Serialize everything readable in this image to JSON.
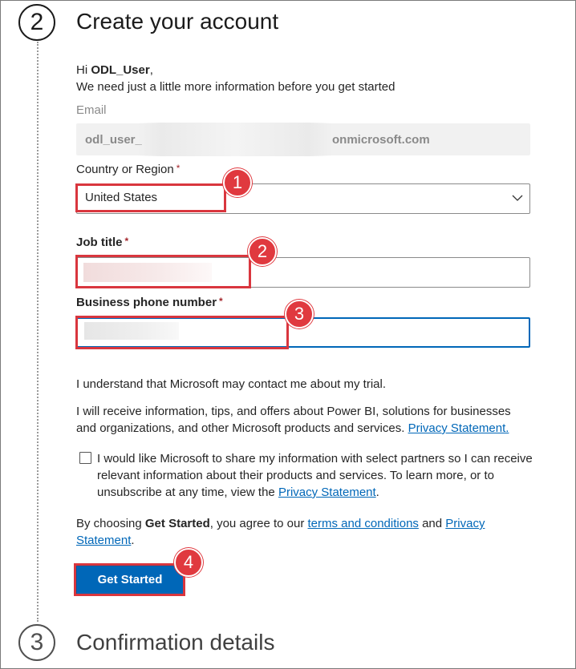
{
  "steps": {
    "current": {
      "number": "2",
      "title": "Create your account"
    },
    "next": {
      "number": "3",
      "title": "Confirmation details"
    }
  },
  "greeting": {
    "hi": "Hi",
    "username": "ODL_User",
    "comma": ",",
    "message": "We need just a little more information before you get started"
  },
  "email": {
    "label": "Email",
    "value_start": "odl_user_",
    "value_end": "onmicrosoft.com"
  },
  "country": {
    "label": "Country or Region",
    "required": "*",
    "value": "United States"
  },
  "job_title": {
    "label": "Job title",
    "required": "*"
  },
  "phone": {
    "label": "Business phone number",
    "required": "*"
  },
  "consent": {
    "contact": "I understand that Microsoft may contact me about my trial.",
    "info": "I will receive information, tips, and offers about Power BI, solutions for businesses and organizations, and other Microsoft products and services.",
    "info_link": "Privacy Statement.",
    "share": "I would like Microsoft to share my information with select partners so I can receive relevant information about their products and services. To learn more, or to unsubscribe at any time, view the",
    "share_link": "Privacy Statement",
    "share_end": ".",
    "agree_prefix": "By choosing",
    "agree_bold": "Get Started",
    "agree_mid": ", you agree to our",
    "terms_link": "terms and conditions",
    "and": "and",
    "privacy_link": "Privacy Statement",
    "agree_end": "."
  },
  "button": {
    "label": "Get Started"
  },
  "annotations": [
    "1",
    "2",
    "3",
    "4"
  ],
  "colors": {
    "accent": "#0067b8",
    "annotation": "#e0393f"
  }
}
